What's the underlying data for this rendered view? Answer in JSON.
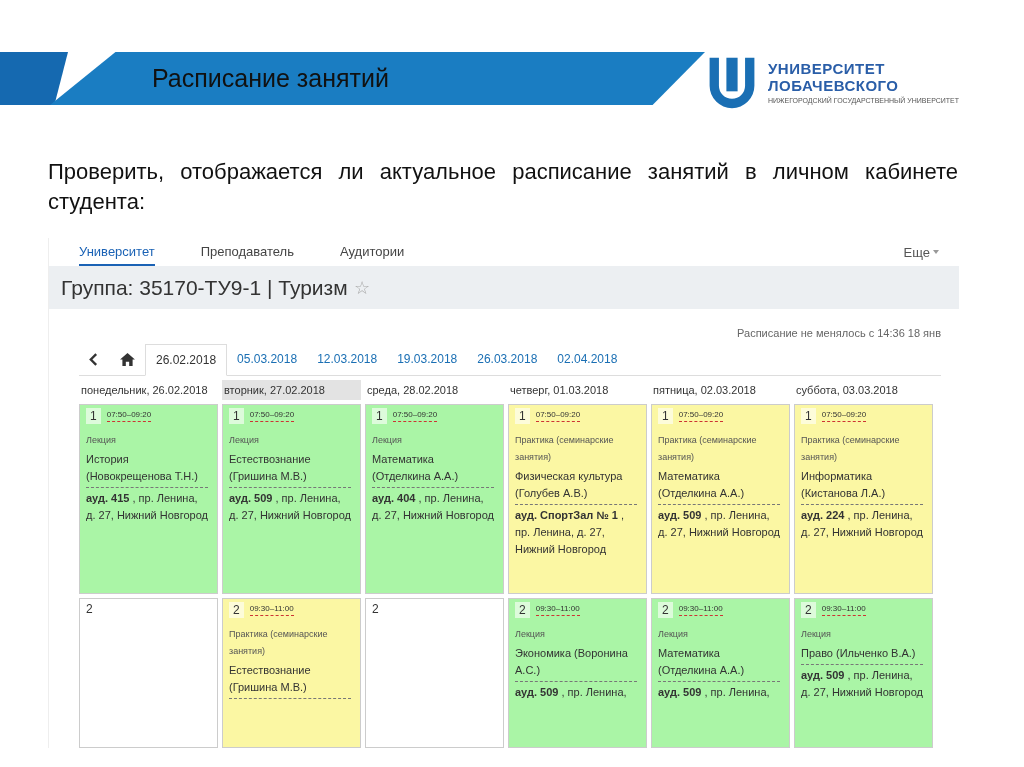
{
  "slide": {
    "title": "Расписание занятий",
    "logo": {
      "line1": "УНИВЕРСИТЕТ",
      "line2": "ЛОБАЧЕВСКОГО",
      "subtitle": "НИЖЕГОРОДСКИЙ ГОСУДАРСТВЕННЫЙ УНИВЕРСИТЕТ"
    },
    "question": "Проверить, отображается ли актуальное расписание занятий в личном кабинете студента:"
  },
  "screenshot": {
    "tabs": [
      {
        "label": "Университет",
        "selected": true
      },
      {
        "label": "Преподаватель",
        "selected": false
      },
      {
        "label": "Аудитории",
        "selected": false
      }
    ],
    "more": "Еще",
    "group_title": "Группа: 35170-ТУ9-1 | Туризм",
    "star": "☆",
    "updated": "Расписание не менялось с 14:36 18 янв",
    "weeks": [
      {
        "label": "26.02.2018",
        "selected": true
      },
      {
        "label": "05.03.2018",
        "selected": false
      },
      {
        "label": "12.03.2018",
        "selected": false
      },
      {
        "label": "19.03.2018",
        "selected": false
      },
      {
        "label": "26.03.2018",
        "selected": false
      },
      {
        "label": "02.04.2018",
        "selected": false
      }
    ],
    "days": [
      {
        "label": "понедельник, 26.02.2018",
        "selected": false
      },
      {
        "label": "вторник, 27.02.2018",
        "selected": true
      },
      {
        "label": "среда, 28.02.2018",
        "selected": false
      },
      {
        "label": "четверг, 01.03.2018",
        "selected": false
      },
      {
        "label": "пятница, 02.03.2018",
        "selected": false
      },
      {
        "label": "суббота, 03.03.2018",
        "selected": false
      }
    ],
    "rows": [
      [
        {
          "kind": "lesson",
          "number": "1",
          "time": "07:50–09:20",
          "type": "Лекция",
          "subject": "История (Новокрещенова Т.Н.)",
          "address": "**ауд. 415** , пр. Ленина, д. 27, Нижний Новгород",
          "color": "#aaf5a6"
        },
        {
          "kind": "lesson",
          "number": "1",
          "time": "07:50–09:20",
          "type": "Лекция",
          "subject": "Естествознание (Гришина М.В.)",
          "address": "**ауд. 509** , пр. Ленина, д. 27, Нижний Новгород",
          "color": "#aaf5a6"
        },
        {
          "kind": "lesson",
          "number": "1",
          "time": "07:50–09:20",
          "type": "Лекция",
          "subject": "Математика (Отделкина А.А.)",
          "address": "**ауд. 404** , пр. Ленина, д. 27, Нижний Новгород",
          "color": "#aaf5a6"
        },
        {
          "kind": "lesson",
          "number": "1",
          "time": "07:50–09:20",
          "type": "Практика (семинарские занятия)",
          "subject": "Физическая культура (Голубев А.В.)",
          "address": "**ауд. СпортЗал № 1** , пр. Ленина, д. 27, Нижний Новгород",
          "color": "#fbf7a3"
        },
        {
          "kind": "lesson",
          "number": "1",
          "time": "07:50–09:20",
          "type": "Практика (семинарские занятия)",
          "subject": "Математика (Отделкина А.А.)",
          "address": "**ауд. 509** , пр. Ленина, д. 27, Нижний Новгород",
          "color": "#fbf7a3"
        },
        {
          "kind": "lesson",
          "number": "1",
          "time": "07:50–09:20",
          "type": "Практика (семинарские занятия)",
          "subject": "Информатика (Кистанова Л.А.)",
          "address": "**ауд. 224** , пр. Ленина, д. 27, Нижний Новгород",
          "color": "#fbf7a3"
        }
      ],
      [
        {
          "kind": "empty",
          "number": "2"
        },
        {
          "kind": "lesson",
          "number": "2",
          "time": "09:30–11:00",
          "type": "Практика (семинарские занятия)",
          "subject": "Естествознание (Гришина М.В.)",
          "color": "#fbf7a3"
        },
        {
          "kind": "empty",
          "number": "2"
        },
        {
          "kind": "lesson",
          "number": "2",
          "time": "09:30–11:00",
          "type": "Лекция",
          "subject": "Экономика (Воронина А.С.)",
          "address": "**ауд. 509** , пр. Ленина,",
          "color": "#aaf5a6"
        },
        {
          "kind": "lesson",
          "number": "2",
          "time": "09:30–11:00",
          "type": "Лекция",
          "subject": "Математика (Отделкина А.А.)",
          "address": "**ауд. 509** , пр. Ленина,",
          "color": "#aaf5a6"
        },
        {
          "kind": "lesson",
          "number": "2",
          "time": "09:30–11:00",
          "type": "Лекция",
          "subject": "Право (Ильченко В.А.)",
          "address": "**ауд. 509** , пр. Ленина, д. 27, Нижний Новгород",
          "color": "#aaf5a6"
        }
      ]
    ]
  }
}
